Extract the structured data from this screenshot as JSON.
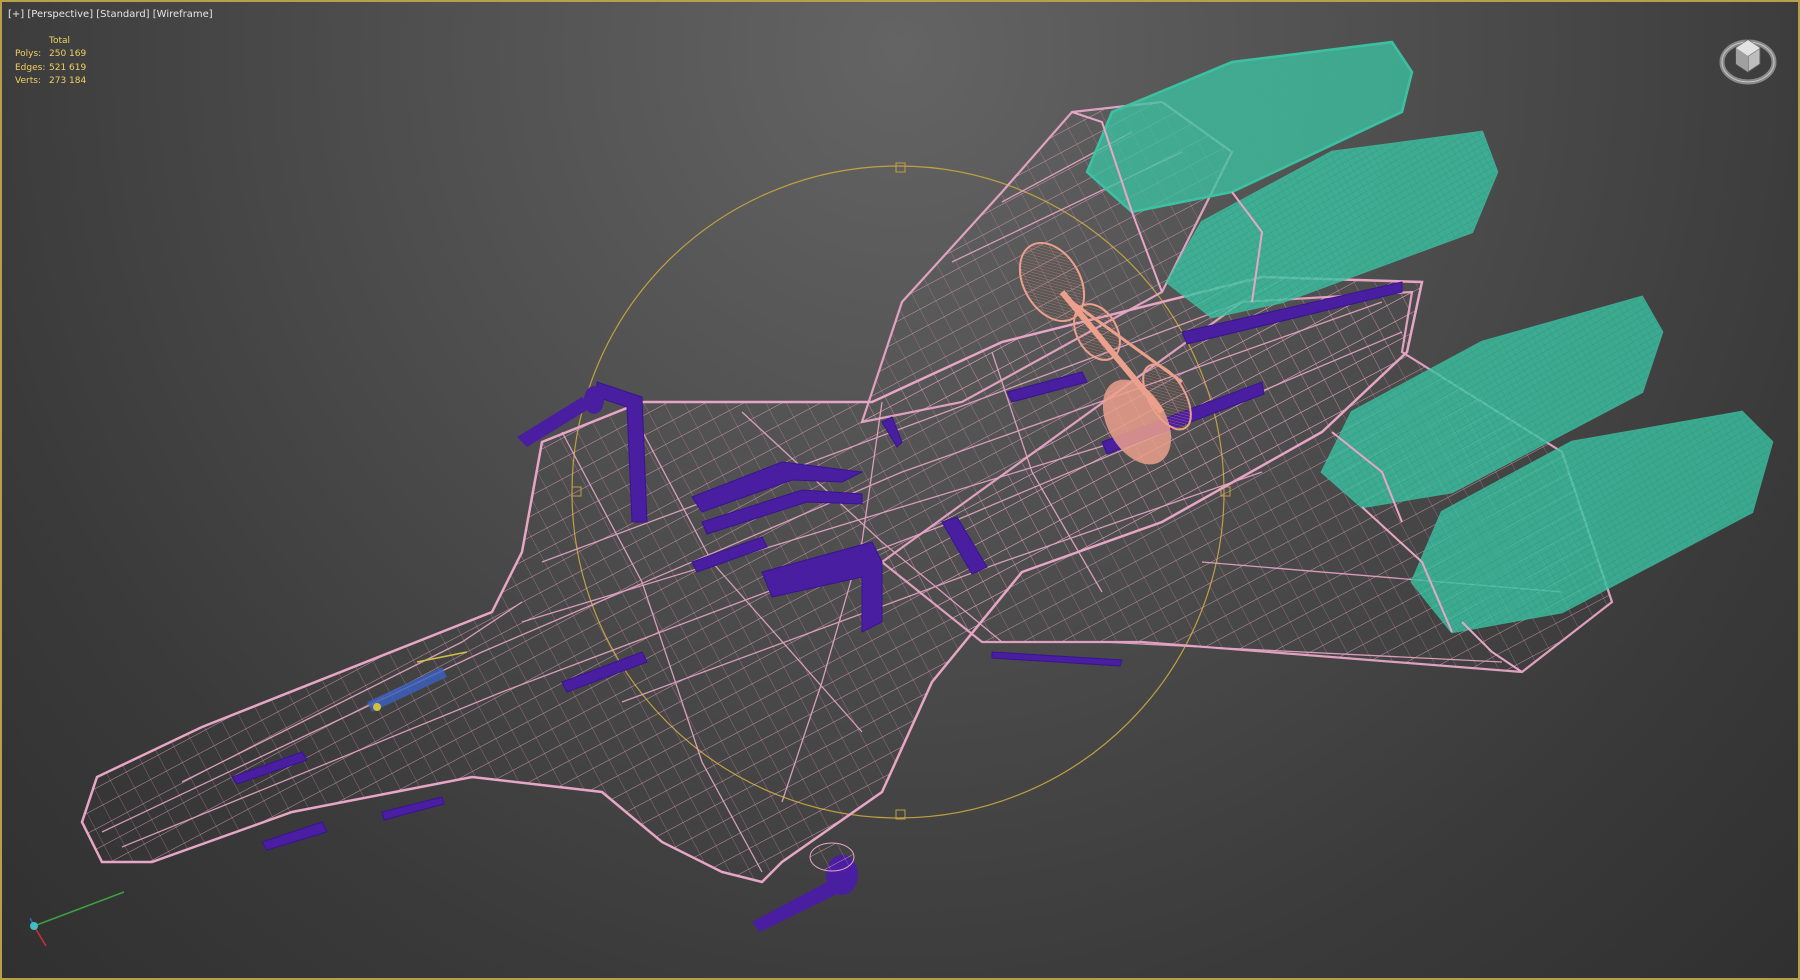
{
  "viewport": {
    "labels": [
      "[+]",
      "[Perspective]",
      "[Standard]",
      "[Wireframe]"
    ],
    "border_color": "#b8a04a"
  },
  "stats": {
    "header": "Total",
    "rows": [
      {
        "label": "Polys:",
        "value": "250 169"
      },
      {
        "label": "Edges:",
        "value": "521 619"
      },
      {
        "label": "Verts:",
        "value": "273 184"
      }
    ],
    "color": "#f0d060"
  },
  "model": {
    "hull_color": "#e8a6c6",
    "engine_color": "#3cc4a4",
    "panel_color": "#4a1ea0",
    "dish_color": "#eca08c",
    "selection_gizmo_color": "#c0a040"
  },
  "icons": {
    "viewcube": "viewcube-icon",
    "axis": "axis-tripod-icon"
  }
}
